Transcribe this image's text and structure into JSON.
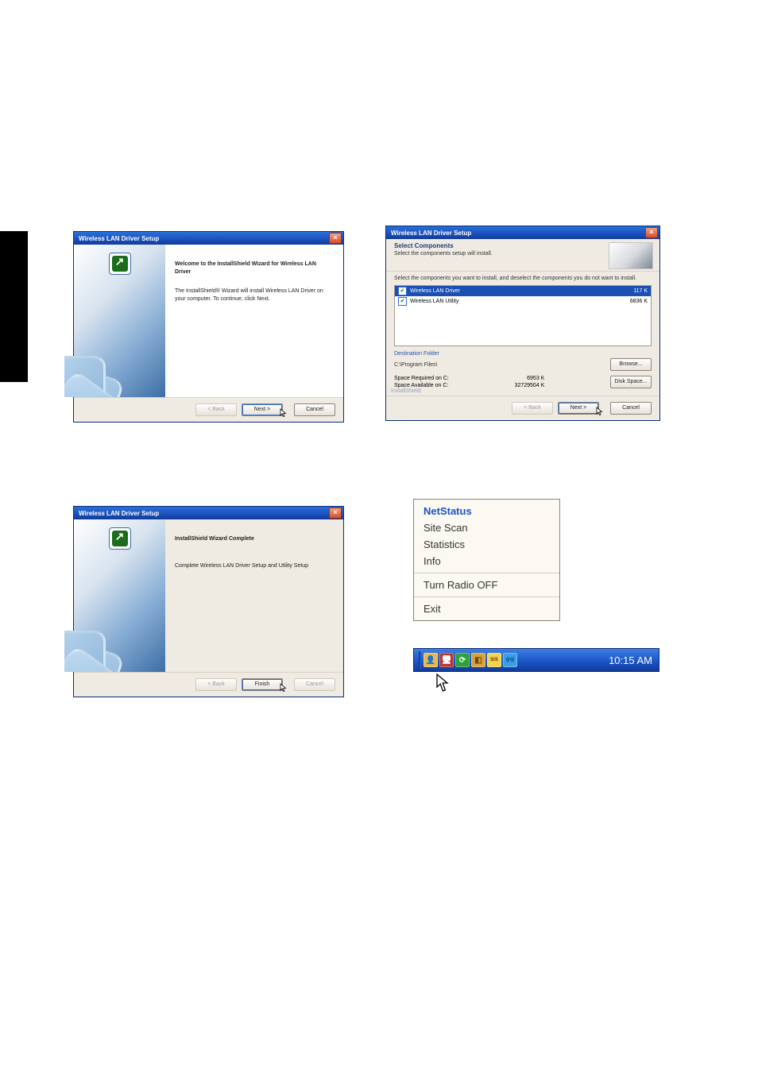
{
  "sidetab": {},
  "dialog_welcome": {
    "title": "Wireless LAN Driver Setup",
    "heading": "Welcome to the InstallShield Wizard for Wireless LAN Driver",
    "body": "The InstallShield® Wizard will install Wireless LAN Driver on your computer.  To continue, click Next.",
    "back": "< Back",
    "next": "Next >",
    "cancel": "Cancel"
  },
  "dialog_components": {
    "title": "Wireless LAN Driver Setup",
    "heading": "Select Components",
    "subheading": "Select the components setup will install.",
    "desc": "Select the components you want to install, and deselect the components you do not want to install.",
    "items": [
      {
        "name": "Wireless LAN Driver",
        "size": "117 K",
        "selected": true,
        "highlighted": true
      },
      {
        "name": "Wireless LAN Utility",
        "size": "6836 K",
        "selected": true,
        "highlighted": false
      }
    ],
    "dest_label": "Destination Folder",
    "dest_path": "C:\\Program Files\\",
    "browse": "Browse...",
    "space_required_lbl": "Space Required on C:",
    "space_required_val": "6953 K",
    "space_available_lbl": "Space Available on C:",
    "space_available_val": "32729504 K",
    "diskspace": "Disk Space...",
    "installshield": "InstallShield",
    "back": "< Back",
    "next": "Next >",
    "cancel": "Cancel"
  },
  "dialog_complete": {
    "title": "Wireless LAN Driver Setup",
    "heading": "InstallShield Wizard Complete",
    "body": "Complete Wireless LAN Driver Setup and Utility Setup",
    "back": "< Back",
    "finish": "Finish",
    "cancel": "Cancel"
  },
  "context_menu": {
    "items": [
      "NetStatus",
      "Site Scan",
      "Statistics",
      "Info"
    ],
    "radio": "Turn Radio OFF",
    "exit": "Exit"
  },
  "taskbar": {
    "icons": [
      {
        "name": "user-icon",
        "glyph": "👤",
        "bg": "#e9b84a",
        "fg": "#8b2a2a"
      },
      {
        "name": "display-icon",
        "glyph": "🖥",
        "bg": "#b53838",
        "fg": "#ffffff"
      },
      {
        "name": "refresh-icon",
        "glyph": "⟳",
        "bg": "#2fa13a",
        "fg": "#ffffff"
      },
      {
        "name": "card-icon",
        "glyph": "◧",
        "bg": "#d8a23a",
        "fg": "#6a4a12"
      },
      {
        "name": "sis-icon",
        "glyph": "SiS",
        "bg": "#f0d44a",
        "fg": "#7a1212"
      },
      {
        "name": "wireless-icon",
        "glyph": "((•))",
        "bg": "#3aa0e6",
        "fg": "#0a2a6a"
      }
    ],
    "clock": "10:15 AM"
  }
}
